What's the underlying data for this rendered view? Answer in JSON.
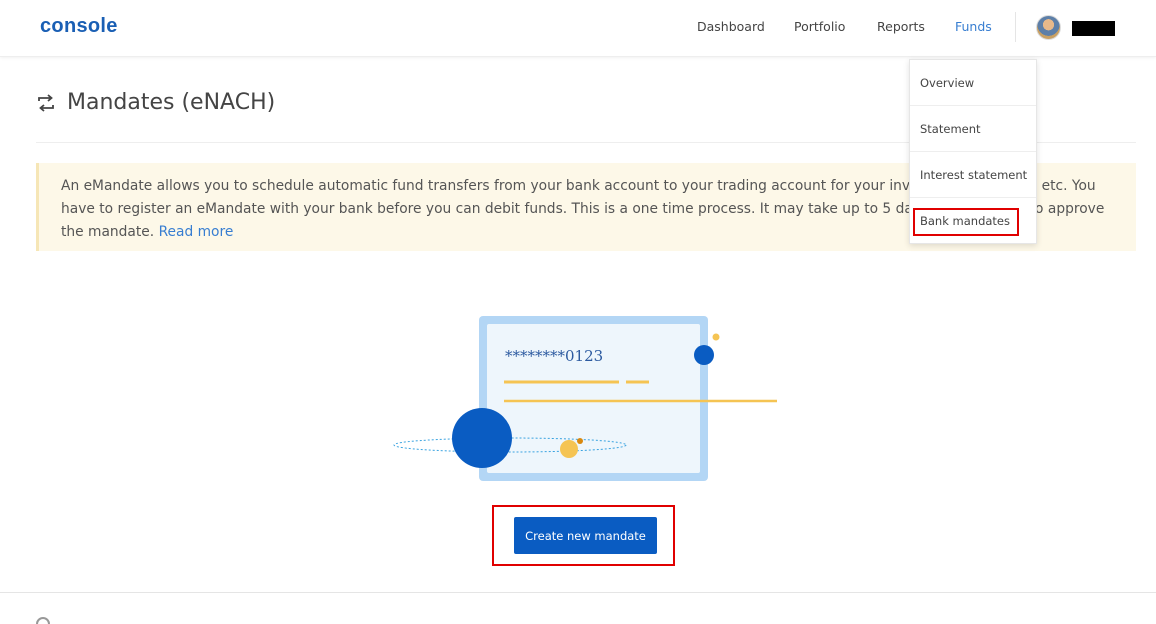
{
  "header": {
    "logo": "console",
    "nav": [
      {
        "label": "Dashboard",
        "active": false
      },
      {
        "label": "Portfolio",
        "active": false
      },
      {
        "label": "Reports",
        "active": false
      },
      {
        "label": "Funds",
        "active": true
      }
    ]
  },
  "funds_menu": {
    "items": [
      "Overview",
      "Statement",
      "Interest statement",
      "Bank mandates"
    ],
    "highlighted_item": "Bank mandates"
  },
  "page": {
    "title": "Mandates (eNACH)",
    "info_text": "An eMandate allows you to schedule automatic fund transfers from your bank account to your trading account for your investments and SIPs etc. You have to register an eMandate with your bank before you can debit funds. This is a one time process. It may take up to 5 days for your bank to approve the mandate.",
    "read_more": "Read more"
  },
  "illustration": {
    "account_mask": "********0123"
  },
  "actions": {
    "create_label": "Create new mandate"
  },
  "colors": {
    "brand": "#1a5fb4",
    "button": "#0a5cc2",
    "highlight_box": "#e00000",
    "info_bg": "#fdf8e8"
  },
  "icons": {
    "title_icon": "swap-arrows-icon",
    "avatar": "user-avatar"
  }
}
